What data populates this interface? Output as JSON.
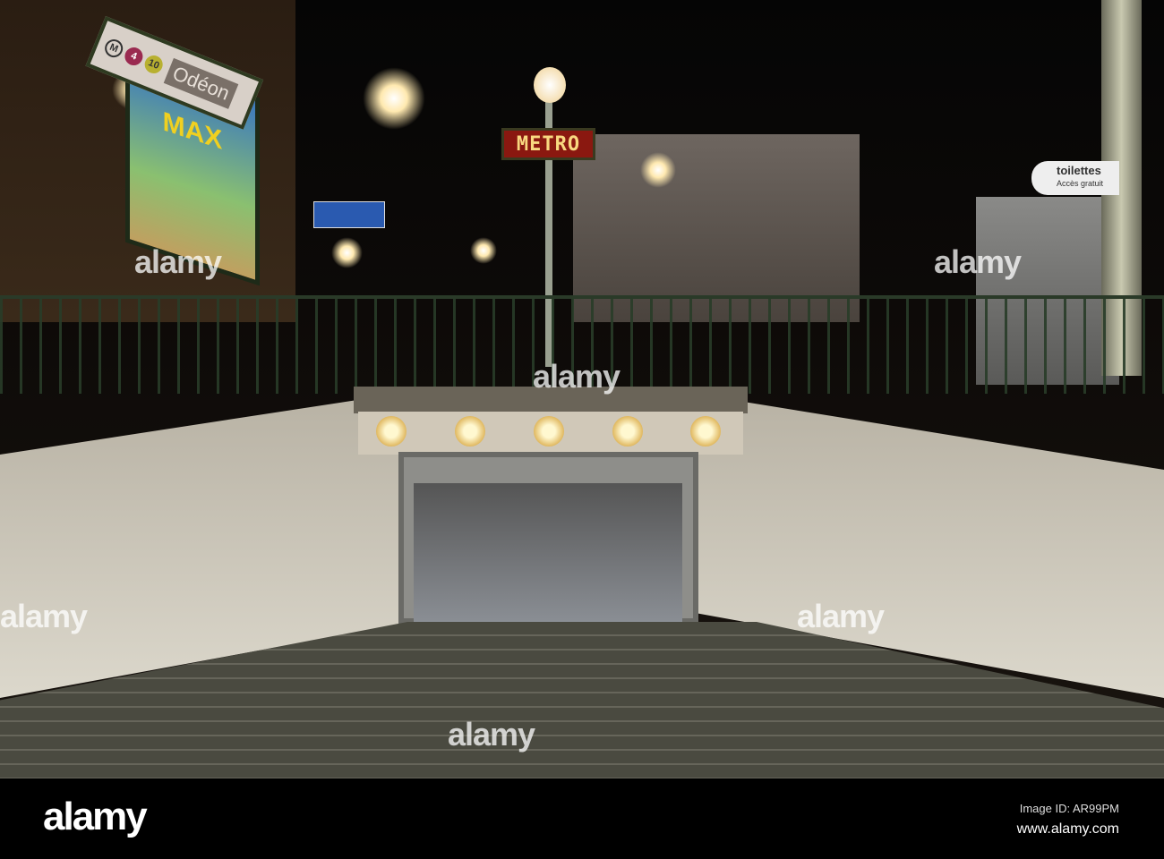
{
  "scene": {
    "station_sign": {
      "line_m": "M",
      "line_4": "4",
      "line_10": "10",
      "station": "Odéon"
    },
    "poster_title": "MAX",
    "metro_sign": "METRO",
    "toilet_sign": {
      "title": "toilettes",
      "subtitle": "Accès gratuit"
    },
    "watermarks": [
      "alamy",
      "alamy",
      "alamy",
      "alamy",
      "alamy",
      "alamy"
    ]
  },
  "footer": {
    "logo": "alamy",
    "image_id": "Image ID: AR99PM",
    "url": "www.alamy.com"
  }
}
